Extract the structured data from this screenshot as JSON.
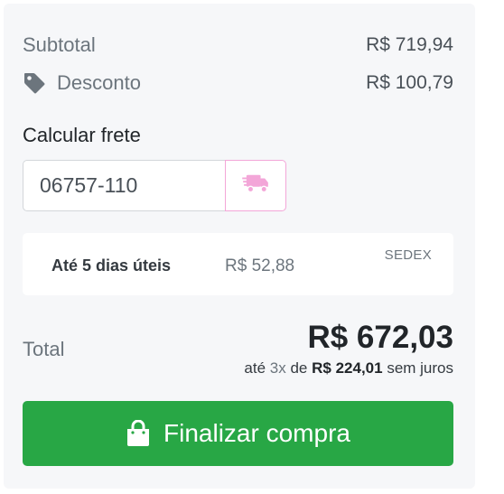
{
  "summary": {
    "subtotal_label": "Subtotal",
    "subtotal_value": "R$ 719,94",
    "discount_label": "Desconto",
    "discount_value": "R$ 100,79"
  },
  "freight": {
    "title": "Calcular frete",
    "cep_value": "06757-110",
    "calc_icon": "truck-icon"
  },
  "shipping_option": {
    "days": "Até 5 dias úteis",
    "price": "R$ 52,88",
    "method": "SEDEX"
  },
  "total": {
    "label": "Total",
    "value": "R$ 672,03",
    "installment_prefix": "até",
    "installment_count": "3x",
    "installment_mid": "de",
    "installment_amount": "R$ 224,01",
    "installment_suffix": "sem juros"
  },
  "checkout": {
    "label": "Finalizar compra",
    "icon": "shopping-bag-icon"
  },
  "colors": {
    "accent_green": "#28a745",
    "truck_pink": "#f3a6d8",
    "card_bg": "#f6f7f9"
  }
}
